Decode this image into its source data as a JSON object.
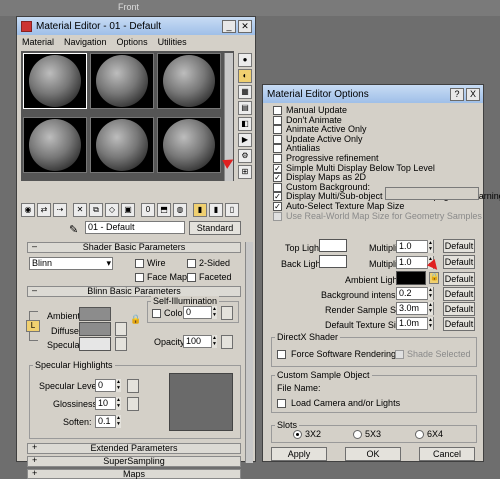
{
  "viewport": {
    "label": "Front"
  },
  "me": {
    "title": "Material Editor - 01 - Default",
    "menu": [
      "Material",
      "Navigation",
      "Options",
      "Utilities"
    ],
    "material_name": "01 - Default",
    "type_button": "Standard",
    "shader_rollout": "Shader Basic Parameters",
    "shader": "Blinn",
    "wire": "Wire",
    "two_sided": "2-Sided",
    "face_map": "Face Map",
    "faceted": "Faceted",
    "blinn_rollout": "Blinn Basic Parameters",
    "self_illum": "Self-Illumination",
    "color": "Color",
    "color_val": "0",
    "ambient": "Ambient:",
    "diffuse": "Diffuse:",
    "specular": "Specular:",
    "opacity": "Opacity:",
    "opacity_val": "100",
    "spec_highlights": "Specular Highlights",
    "spec_level": "Specular Level:",
    "spec_level_val": "0",
    "glossiness": "Glossiness:",
    "glossiness_val": "10",
    "soften": "Soften:",
    "soften_val": "0.1",
    "extended": "Extended Parameters",
    "supersampling": "SuperSampling",
    "maps": "Maps",
    "lock": "L",
    "swatch_colors": {
      "ambient": "#8c8c8c",
      "diffuse": "#8c8c8c",
      "specular": "#e6e6e6",
      "preview": "#6a6a6a"
    }
  },
  "opt": {
    "title": "Material Editor Options",
    "checks": [
      {
        "label": "Manual Update",
        "checked": false,
        "disabled": false
      },
      {
        "label": "Don't Animate",
        "checked": false,
        "disabled": false
      },
      {
        "label": "Animate Active Only",
        "checked": false,
        "disabled": false
      },
      {
        "label": "Update Active Only",
        "checked": false,
        "disabled": false
      },
      {
        "label": "Antialias",
        "checked": false,
        "disabled": false
      },
      {
        "label": "Progressive refinement",
        "checked": false,
        "disabled": false
      },
      {
        "label": "Simple Multi Display Below Top Level",
        "checked": true,
        "disabled": false
      },
      {
        "label": "Display Maps as 2D",
        "checked": true,
        "disabled": false
      },
      {
        "label": "Custom Background:",
        "checked": false,
        "disabled": false
      },
      {
        "label": "Display Multi/Sub-object Material Propagation Warning",
        "checked": true,
        "disabled": false
      },
      {
        "label": "Auto-Select Texture Map Size",
        "checked": true,
        "disabled": false
      },
      {
        "label": "Use Real-World Map Size for Geometry Samples",
        "checked": false,
        "disabled": true
      }
    ],
    "top_light": "Top Light:",
    "back_light": "Back Light:",
    "multiplier": "Multiplier:",
    "top_mult": "1.0",
    "back_mult": "1.0",
    "default": "Default",
    "ambient_light": "Ambient Light:",
    "bg_intensity": "Background intensity:",
    "bg_intensity_val": "0.2",
    "render_sample": "Render Sample Size:",
    "render_sample_val": "3.0m",
    "default_texture": "Default Texture Size:",
    "default_texture_val": "1.0m",
    "directx": "DirectX Shader",
    "force_sw": "Force Software Rendering",
    "shade_selected": "Shade Selected",
    "custom_obj": "Custom Sample Object",
    "file_name": "File Name:",
    "load_cam": "Load Camera and/or Lights",
    "slots": "Slots",
    "slot_options": [
      "3X2",
      "5X3",
      "6X4"
    ],
    "apply": "Apply",
    "ok": "OK",
    "cancel": "Cancel",
    "help": "?",
    "close": "X"
  }
}
